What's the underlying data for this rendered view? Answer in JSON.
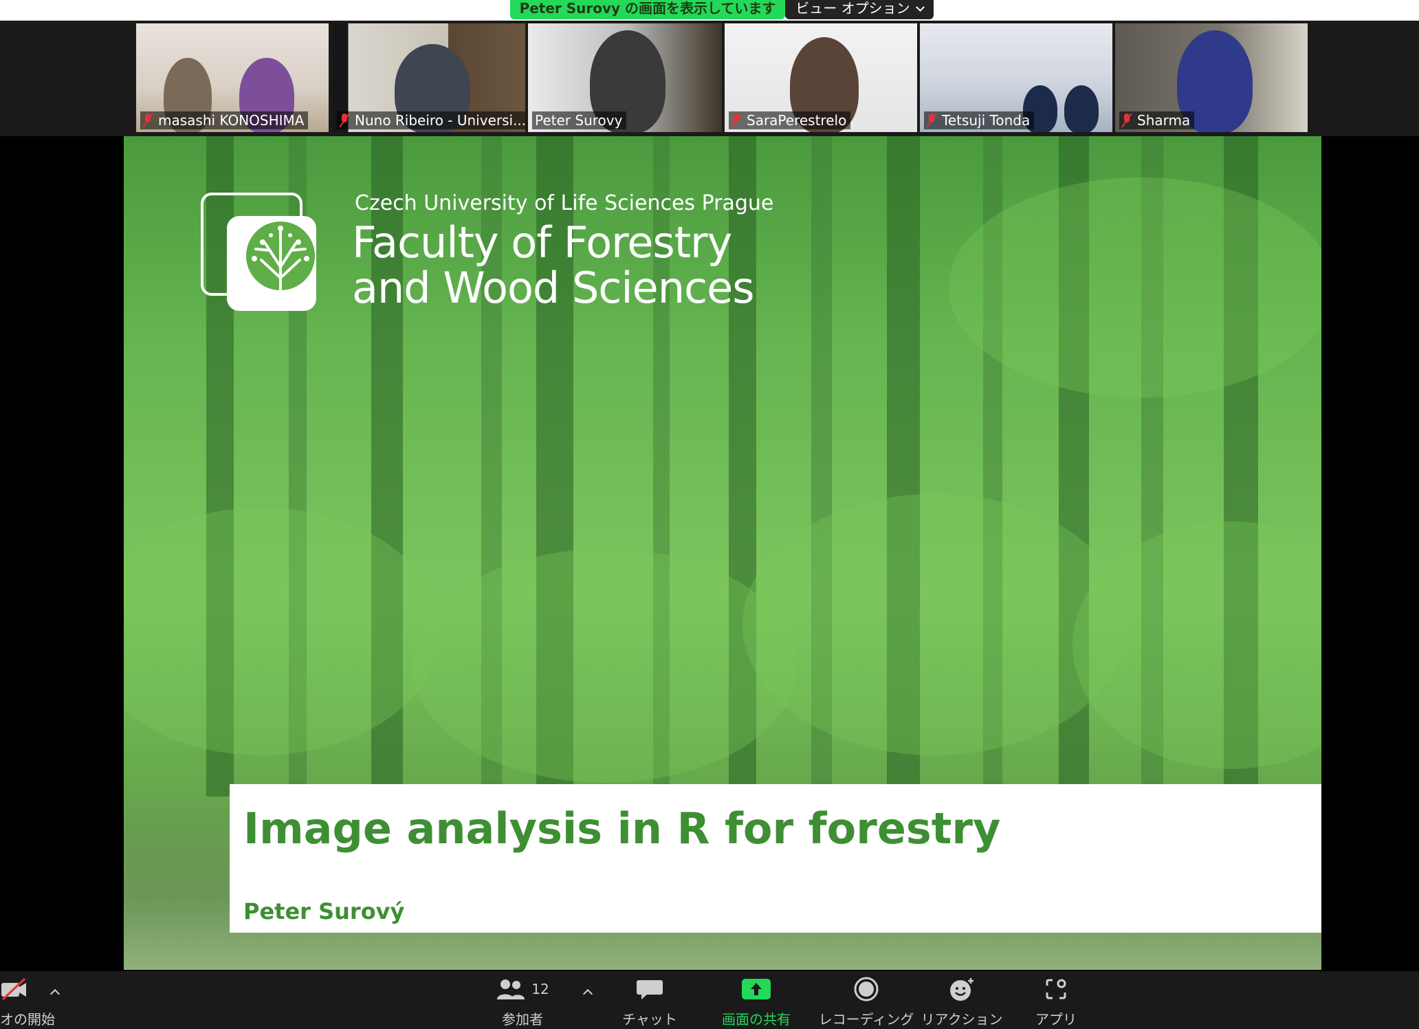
{
  "share_banner": {
    "text": "Peter  Surovy の画面を表示しています"
  },
  "view_options": {
    "label": "ビュー オプション"
  },
  "participants": [
    {
      "name": "masashi KONOSHIMA",
      "muted": true,
      "active": false
    },
    {
      "name": "Nuno Ribeiro - Universi...",
      "muted": true,
      "active": false
    },
    {
      "name": "Peter Surovy",
      "muted": false,
      "active": true
    },
    {
      "name": "SaraPerestrelo",
      "muted": true,
      "active": false
    },
    {
      "name": "Tetsuji Tonda",
      "muted": true,
      "active": false
    },
    {
      "name": "Sharma",
      "muted": true,
      "active": false
    }
  ],
  "slide": {
    "university": "Czech University of Life Sciences Prague",
    "faculty_line1": "Faculty of Forestry",
    "faculty_line2": "and Wood Sciences",
    "title": "Image analysis in R for forestry",
    "author": "Peter Surový"
  },
  "toolbar": {
    "video_label": "オの開始",
    "participants_label": "参加者",
    "participants_count": "12",
    "chat_label": "チャット",
    "share_label": "画面の共有",
    "record_label": "レコーディング",
    "reactions_label": "リアクション",
    "apps_label": "アプリ"
  },
  "colors": {
    "accent_green": "#23d959",
    "slide_title_green": "#3e8f33",
    "muted_red": "#e0343a",
    "active_border": "#c8e06a"
  }
}
